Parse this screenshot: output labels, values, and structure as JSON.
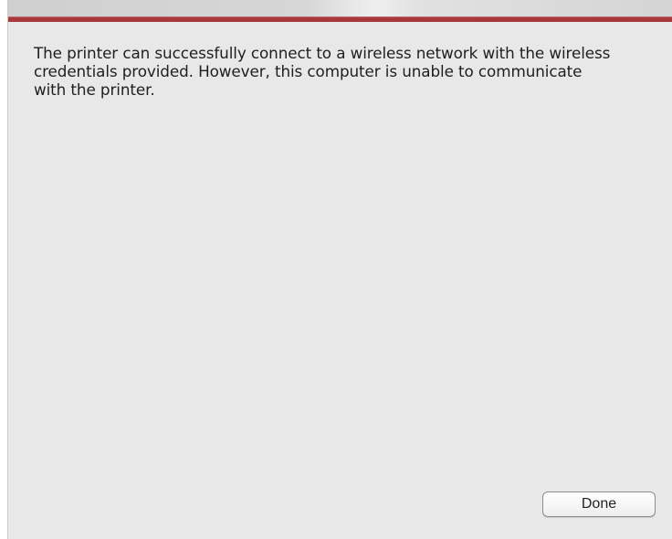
{
  "dialog": {
    "message": "The printer can successfully connect to a wireless network with the wireless credentials provided. However, this computer is unable to communicate with the printer.",
    "done_label": "Done"
  },
  "colors": {
    "accent": "#a7383b",
    "background": "#e8e8e8",
    "text": "#1f1f1f"
  }
}
